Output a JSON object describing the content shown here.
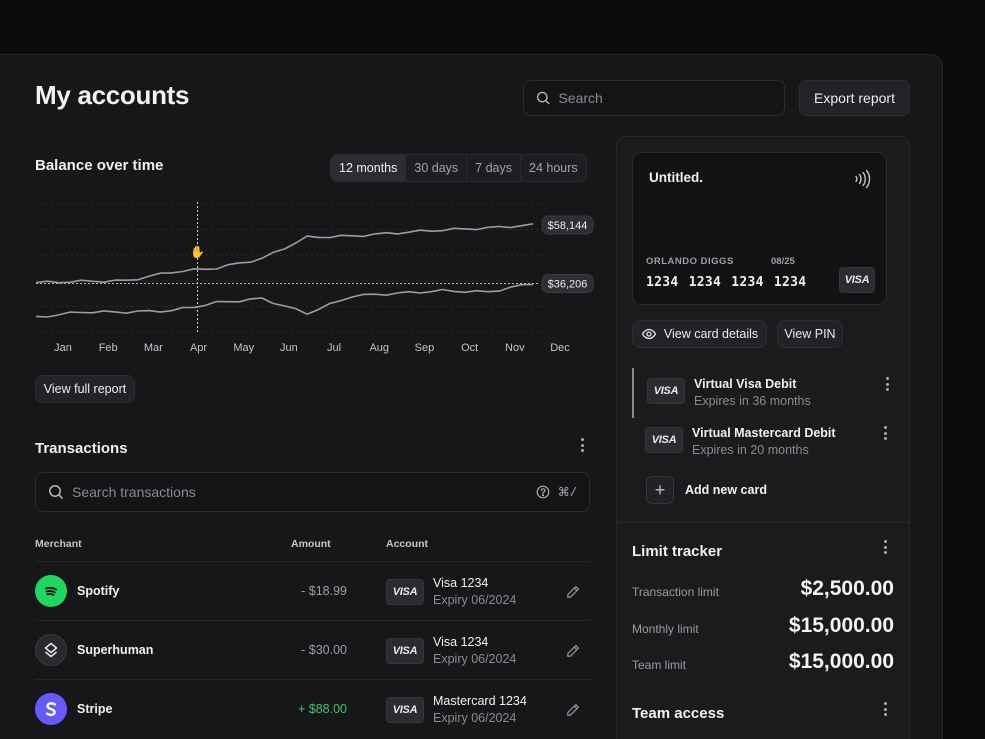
{
  "header": {
    "title": "My accounts",
    "search_placeholder": "Search",
    "export_label": "Export report"
  },
  "balance": {
    "title": "Balance over time",
    "ranges": [
      "12 months",
      "30 days",
      "7 days",
      "24 hours"
    ],
    "view_full_label": "View full report"
  },
  "chart_data": {
    "type": "line",
    "categories": [
      "Jan",
      "Feb",
      "Mar",
      "Apr",
      "May",
      "Jun",
      "Jul",
      "Aug",
      "Sep",
      "Oct",
      "Nov",
      "Dec"
    ],
    "series": [
      {
        "values": [
          36500,
          37000,
          37200,
          40500,
          42000,
          45500,
          53500,
          54000,
          55200,
          56300,
          57000,
          58144
        ],
        "end_label": "$58,144"
      },
      {
        "values": [
          23500,
          25500,
          25500,
          26000,
          29000,
          30500,
          25000,
          31500,
          32500,
          33500,
          33000,
          36206
        ],
        "end_label": "$36,206"
      }
    ],
    "reference_value": 36206,
    "grid": true,
    "hover_month": "Apr"
  },
  "transactions": {
    "title": "Transactions",
    "search_placeholder": "Search transactions",
    "shortcut": "⌘/",
    "columns": {
      "merchant": "Merchant",
      "amount": "Amount",
      "account": "Account"
    },
    "rows": [
      {
        "merchant": "Spotify",
        "amount": "- $18.99",
        "account": "Visa 1234",
        "expiry": "Expiry 06/2024",
        "badge": "VISA"
      },
      {
        "merchant": "Superhuman",
        "amount": "- $30.00",
        "account": "Visa 1234",
        "expiry": "Expiry 06/2024",
        "badge": "VISA"
      },
      {
        "merchant": "Stripe",
        "amount": "+ $88.00",
        "account": "Mastercard 1234",
        "expiry": "Expiry 06/2024",
        "badge": "VISA"
      }
    ]
  },
  "card": {
    "title": "Untitled.",
    "holder": "ORLANDO DIGGS",
    "expiry": "08/25",
    "number": "1234 1234 1234 1234",
    "brand": "VISA",
    "view_details_label": "View card details",
    "view_pin_label": "View PIN"
  },
  "virtual_cards": [
    {
      "badge": "VISA",
      "name": "Virtual Visa Debit",
      "expires": "Expires in 36 months"
    },
    {
      "badge": "VISA",
      "name": "Virtual Mastercard Debit",
      "expires": "Expires in 20 months"
    }
  ],
  "add_card_label": "Add new card",
  "limits": {
    "title": "Limit tracker",
    "items": [
      {
        "label": "Transaction limit",
        "value": "$2,500.00"
      },
      {
        "label": "Monthly limit",
        "value": "$15,000.00"
      },
      {
        "label": "Team limit",
        "value": "$15,000.00"
      }
    ]
  },
  "team_access": {
    "title": "Team access"
  },
  "colors": {
    "positive": "#3ec46d",
    "spotify": "#1ed760",
    "stripe": "#635bff"
  }
}
